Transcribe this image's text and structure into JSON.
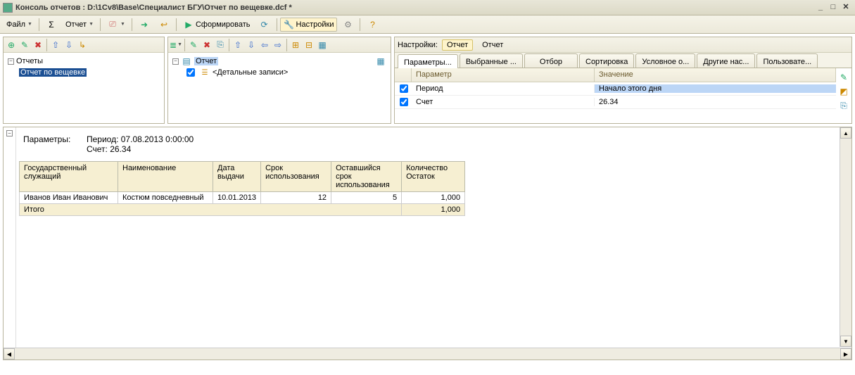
{
  "window": {
    "title": "Консоль отчетов : D:\\1Cv8\\Base\\Специалист БГУ\\Отчет по вещевке.dcf *"
  },
  "main_toolbar": {
    "file": "Файл",
    "report": "Отчет",
    "form": "Сформировать",
    "settings": "Настройки"
  },
  "left_tree": {
    "root": "Отчеты",
    "item": "Отчет по вещевке"
  },
  "struct_tree": {
    "root": "Отчет",
    "detail": "<Детальные записи>"
  },
  "settings": {
    "label": "Настройки:",
    "mode_report1": "Отчет",
    "mode_report2": "Отчет",
    "tabs": {
      "params": "Параметры...",
      "selected": "Выбранные ...",
      "filter": "Отбор",
      "sort": "Сортировка",
      "cond": "Условное о...",
      "other": "Другие нас...",
      "user": "Пользовате..."
    },
    "hdr_param": "Параметр",
    "hdr_value": "Значение",
    "rows": [
      {
        "name": "Период",
        "value": "Начало этого дня"
      },
      {
        "name": "Счет",
        "value": "26.34"
      }
    ]
  },
  "report": {
    "params_label": "Параметры:",
    "period_line": "Период: 07.08.2013 0:00:00",
    "account_line": "Счет: 26.34",
    "columns": {
      "c1": "Государственный служащий",
      "c2": "Наименование",
      "c3": "Дата выдачи",
      "c4": "Срок использования",
      "c5": "Оставшийся срок использования",
      "c6": "Количество Остаток"
    },
    "row": {
      "c1": "Иванов Иван Иванович",
      "c2": "Костюм повседневный",
      "c3": "10.01.2013",
      "c4": "12",
      "c5": "5",
      "c6": "1,000"
    },
    "total_label": "Итого",
    "total_value": "1,000"
  }
}
